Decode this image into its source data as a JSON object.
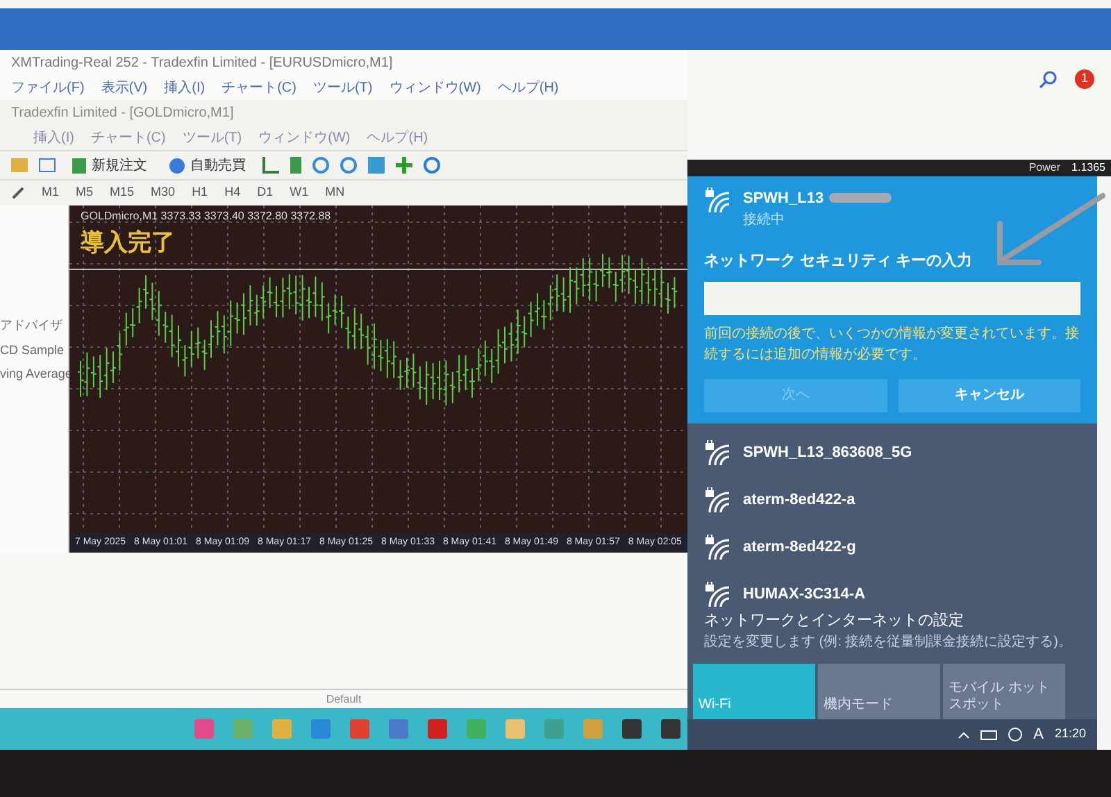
{
  "mt4": {
    "window_title": "XMTrading-Real 252 - Tradexfin Limited - [EURUSDmicro,M1]",
    "menu": [
      "ファイル(F)",
      "表示(V)",
      "挿入(I)",
      "チャート(C)",
      "ツール(T)",
      "ウィンドウ(W)",
      "ヘルプ(H)"
    ],
    "chart_window_title": "Tradexfin Limited - [GOLDmicro,M1]",
    "chart_menu": [
      "挿入(I)",
      "チャート(C)",
      "ツール(T)",
      "ウィンドウ(W)",
      "ヘルプ(H)"
    ],
    "toolbar_buttons": [
      {
        "label": "新規注文"
      },
      {
        "label": "自動売買"
      }
    ],
    "timeframes": [
      "M1",
      "M5",
      "M15",
      "M30",
      "H1",
      "H4",
      "D1",
      "W1",
      "MN"
    ],
    "navigator": [
      "アドバイザ",
      "CD Sample",
      "ving Average"
    ],
    "chart": {
      "header": "GOLDmicro,M1 3373.33 3373.40 3372.80 3372.88",
      "overlay": "導入完了",
      "time_labels": [
        "7 May 2025",
        "8 May 01:01",
        "8 May 01:09",
        "8 May 01:17",
        "8 May 01:25",
        "8 May 01:33",
        "8 May 01:41",
        "8 May 01:49",
        "8 May 01:57",
        "8 May 02:05"
      ]
    },
    "status": "Default"
  },
  "right_toolbar": {
    "notification_count": "1",
    "label": "Power",
    "price": "1.1365"
  },
  "wifi": {
    "connecting": {
      "ssid": "SPWH_L13",
      "status": "接続中",
      "key_label": "ネットワーク セキュリティ キーの入力",
      "message": "前回の接続の後で、いくつかの情報が変更されています。接続するには追加の情報が必要です。",
      "buttons": [
        {
          "label": "次へ",
          "disabled": true
        },
        {
          "label": "キャンセル",
          "disabled": false
        }
      ]
    },
    "networks": [
      {
        "ssid": "SPWH_L13_863608_5G",
        "secured": true
      },
      {
        "ssid": "aterm-8ed422-a",
        "secured": true
      },
      {
        "ssid": "aterm-8ed422-g",
        "secured": true
      },
      {
        "ssid": "HUMAX-3C314-A",
        "secured": true
      }
    ],
    "settings": {
      "title": "ネットワークとインターネットの設定",
      "subtitle": "設定を変更します (例: 接続を従量制課金接続に設定する)。"
    },
    "tiles": [
      {
        "label": "Wi-Fi",
        "on": true
      },
      {
        "label": "機内モード",
        "on": false
      },
      {
        "label": "モバイル ホットスポット",
        "on": false
      }
    ]
  },
  "taskbar": {
    "ime": "A",
    "time": "21:20"
  }
}
